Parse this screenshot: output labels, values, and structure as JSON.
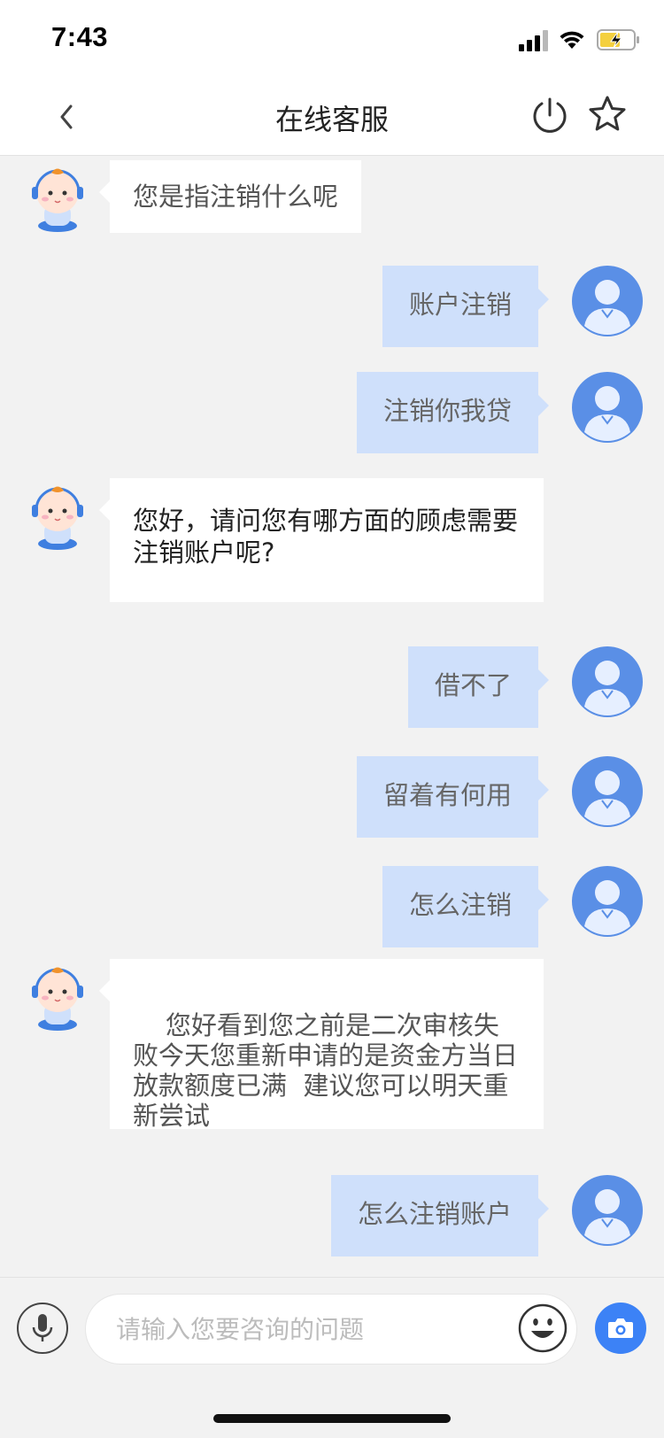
{
  "status_bar": {
    "time": "7:43"
  },
  "nav": {
    "title": "在线客服"
  },
  "messages": [
    {
      "from": "bot",
      "text": "您是指注销什么呢"
    },
    {
      "from": "user",
      "text": "账户注销"
    },
    {
      "from": "user",
      "text": "注销你我贷"
    },
    {
      "from": "bot",
      "text": "您好，请问您有哪方面的顾虑需要注销账户呢?"
    },
    {
      "from": "user",
      "text": "借不了"
    },
    {
      "from": "user",
      "text": "留着有何用"
    },
    {
      "from": "user",
      "text": "怎么注销"
    },
    {
      "from": "bot",
      "text": "您好看到您之前是二次审核失败今天您重新申请的是资金方当日放款额度已满  建议您可以明天重新尝试"
    },
    {
      "from": "user",
      "text": "怎么注销账户"
    }
  ],
  "input": {
    "placeholder": "请输入您要咨询的问题",
    "value": ""
  },
  "colors": {
    "accent": "#3c82f6",
    "user_bubble": "#cfe0fb",
    "user_avatar": "#5a8fe6",
    "battery": "#f4d03f"
  },
  "icons": {
    "back": "chevron-left-icon",
    "power": "power-icon",
    "favorite": "star-icon",
    "mic": "microphone-icon",
    "emoji": "smiley-icon",
    "camera": "camera-icon"
  }
}
